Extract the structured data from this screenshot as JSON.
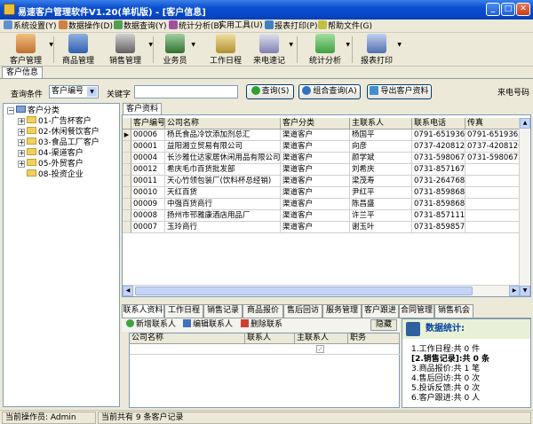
{
  "window": {
    "title": "易速客户管理软件V1.20(单机版) - [客户信息]"
  },
  "menu": [
    "系统设置(Y)",
    "数据操作(D)",
    "数据查询(Y)",
    "统计分析(B)",
    "实用工具(U)",
    "报表打印(P)",
    "帮助文件(G)"
  ],
  "toolbar": [
    "客户管理",
    "商品管理",
    "销售管理",
    "业务员",
    "工作日程",
    "来电速记",
    "统计分析",
    "报表打印"
  ],
  "doc_tab": "客户信息",
  "query": {
    "condition_label": "查询条件",
    "condition_value": "客户编号",
    "keyword_label": "关键字",
    "keyword_value": "",
    "query_btn": "查询(S)",
    "combo_btn": "组合查询(A)",
    "export_btn": "导出客户资料",
    "right_label": "来电号码"
  },
  "tree": {
    "root": "客户分类",
    "items": [
      "01-广告杯客户",
      "02-休闲餐饮客户",
      "03-食品工厂客户",
      "04-渠道客户",
      "05-外贸客户",
      "08-投资企业"
    ]
  },
  "grid_tab": "客户资料",
  "grid": {
    "columns": [
      "客户编号",
      "公司名称",
      "客户分类",
      "主联系人",
      "联系电话",
      "传真"
    ],
    "rows": [
      [
        "00006",
        "杨氏食品冷饮添加剂总汇",
        "渠道客户",
        "杨国平",
        "0791-6519365",
        "0791-6519365"
      ],
      [
        "00001",
        "益阳湘立贸易有限公司",
        "渠道客户",
        "向彦",
        "0737-4208126",
        "0737-4208126"
      ],
      [
        "00004",
        "长沙雅仕达家居休闲用品有限公司",
        "渠道客户",
        "颜学斌",
        "0731-5980672/7",
        "0731-5980672"
      ],
      [
        "00012",
        "希庆毛巾百货批发部",
        "渠道客户",
        "刘希庆",
        "0731-85716791",
        ""
      ],
      [
        "00011",
        "天心竹领包装厂(饮料杯总经销)",
        "渠道客户",
        "梁茂寿",
        "0731-2647681/5",
        ""
      ],
      [
        "00010",
        "天红百货",
        "渠道客户",
        "尹红平",
        "0731-85986816",
        ""
      ],
      [
        "00009",
        "中强百货商行",
        "渠道客户",
        "陈昌盛",
        "0731-85986803",
        ""
      ],
      [
        "00008",
        "扬州市邗雅康酒店用品厂",
        "渠道客户",
        "许兰平",
        "0731-85711112",
        ""
      ],
      [
        "00007",
        "玉玲商行",
        "渠道客户",
        "谢玉叶",
        "0731-85985792",
        ""
      ]
    ]
  },
  "bottom_tabs": [
    "联系人资料",
    "工作日程",
    "销售记录",
    "商品报价",
    "售后回访",
    "服务管理",
    "客户跟进",
    "合同管理",
    "销售机会"
  ],
  "contact_toolbar": {
    "add": "新增联系人",
    "edit": "编辑联系人",
    "delete": "删除联系",
    "hide": "隐藏"
  },
  "contact_columns": [
    "公司名称",
    "联系人",
    "主联系人",
    "职务"
  ],
  "stats": {
    "title": "数据统计:",
    "items": [
      "1.工作日程:共 0 件",
      "[2.销售记录]:共 0 条",
      "3.商品报价:共 1 笔",
      "4.售后回访:共 0 次",
      "5.投诉反馈:共 0 次",
      "6.客户跟进:共 0 人"
    ]
  },
  "status": {
    "operator": "当前操作员: Admin",
    "records": "当前共有 9 条客户记录"
  }
}
